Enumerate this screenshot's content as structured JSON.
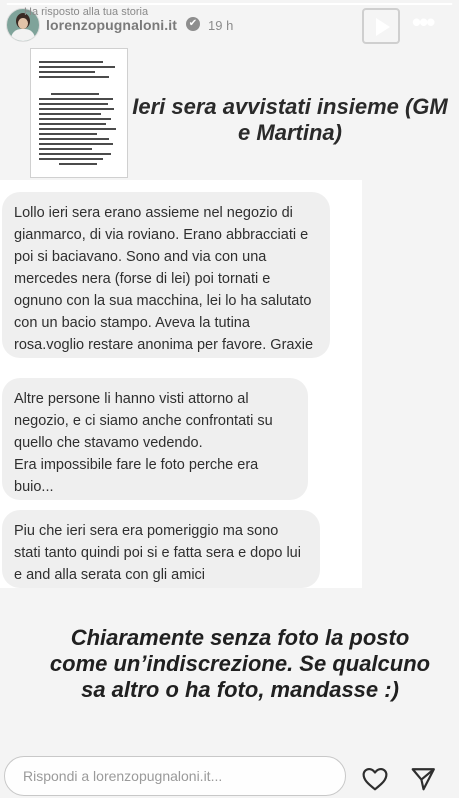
{
  "header": {
    "replied_label": "Ha risposto alla tua storia",
    "username": "lorenzopugnaloni.it",
    "verified_glyph": "✔",
    "time": "19 h",
    "progress": 1.0
  },
  "story": {
    "headline": "Ieri sera avvistati insieme (GM e Martina)",
    "messages": [
      "Lollo ieri sera erano assieme nel negozio di gianmarco, di via roviano. Erano abbracciati e poi si baciavano. Sono and via con una mercedes nera (forse di lei) poi tornati e ognuno con la sua macchina, lei lo ha salutato con un bacio stampo. Aveva la tutina rosa.voglio restare anonima per favore. Graxie",
      "Altre persone li hanno visti attorno al negozio, e ci siamo anche confrontati su quello che stavamo vedendo.\nEra impossibile fare le foto perche era buio...",
      "Piu che ieri sera era pomeriggio ma sono stati tanto quindi poi si e fatta sera e dopo lui e and alla serata con gli amici"
    ],
    "caption": "Chiaramente senza foto la posto come un’indiscrezione. Se qualcuno sa altro o ha foto, mandasse :)"
  },
  "reply": {
    "placeholder": "Rispondi a lorenzopugnaloni.it..."
  },
  "icons": {
    "play": "play-icon",
    "more": "more-icon",
    "like": "heart-icon",
    "send": "send-icon"
  }
}
